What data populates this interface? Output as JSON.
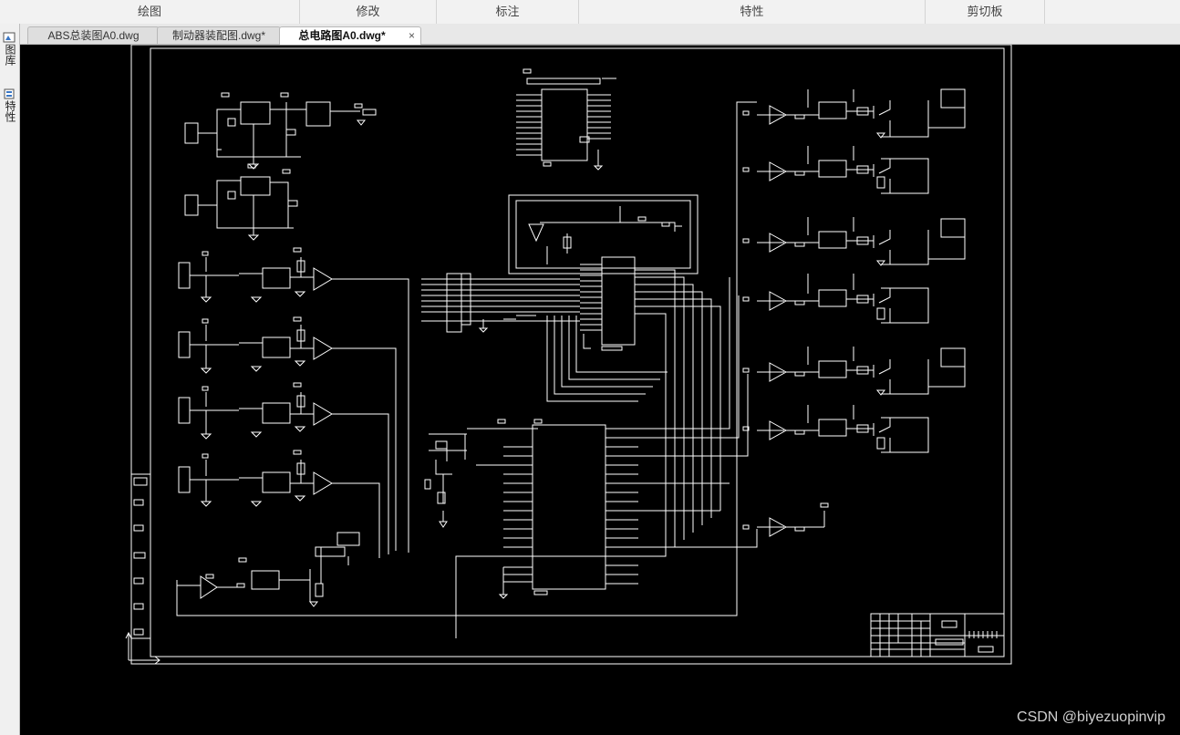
{
  "ribbon": {
    "groups": [
      "绘图",
      "修改",
      "标注",
      "特性",
      "剪切板"
    ]
  },
  "tabs": [
    {
      "label": "ABS总装图A0.dwg"
    },
    {
      "label": "制动器装配图.dwg*"
    },
    {
      "label": "总电路图A0.dwg*",
      "active": true
    }
  ],
  "tab_close_glyph": "×",
  "side_palette": {
    "items": [
      "图库",
      "特性"
    ]
  },
  "drawing": {
    "background": "#000000",
    "line_color": "#ffffff"
  },
  "watermark": "CSDN @biyezuopinvip"
}
